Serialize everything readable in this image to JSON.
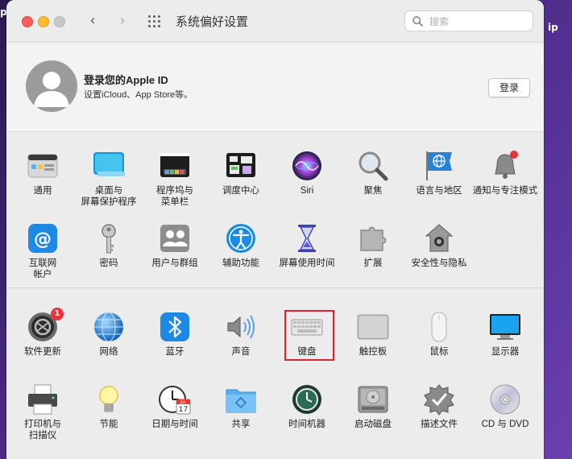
{
  "desktop": {
    "left_text": "p",
    "right_text": "ip"
  },
  "window": {
    "title": "系统偏好设置",
    "search_placeholder": "搜索",
    "back_symbol": "‹",
    "forward_symbol": "›"
  },
  "account": {
    "title": "登录您的Apple ID",
    "subtitle": "设置iCloud、App Store等。",
    "login_button": "登录"
  },
  "section1": [
    {
      "label": "通用",
      "icon": "general-icon"
    },
    {
      "label": "桌面与\n屏幕保护程序",
      "icon": "desktop-icon"
    },
    {
      "label": "程序坞与\n菜单栏",
      "icon": "dock-icon"
    },
    {
      "label": "调度中心",
      "icon": "mission-control-icon"
    },
    {
      "label": "Siri",
      "icon": "siri-icon"
    },
    {
      "label": "聚焦",
      "icon": "spotlight-icon"
    },
    {
      "label": "语言与地区",
      "icon": "language-icon"
    },
    {
      "label": "通知与专注模式",
      "icon": "notifications-icon"
    },
    {
      "label": "互联网\n帐户",
      "icon": "internet-accounts-icon"
    },
    {
      "label": "密码",
      "icon": "key-icon"
    },
    {
      "label": "用户与群组",
      "icon": "users-icon"
    },
    {
      "label": "辅助功能",
      "icon": "accessibility-icon"
    },
    {
      "label": "屏幕使用时间",
      "icon": "screen-time-icon"
    },
    {
      "label": "扩展",
      "icon": "extensions-icon"
    },
    {
      "label": "安全性与隐私",
      "icon": "security-icon"
    }
  ],
  "section2": [
    {
      "label": "软件更新",
      "icon": "software-update-icon",
      "badge": "1"
    },
    {
      "label": "网络",
      "icon": "network-icon"
    },
    {
      "label": "蓝牙",
      "icon": "bluetooth-icon"
    },
    {
      "label": "声音",
      "icon": "sound-icon"
    },
    {
      "label": "键盘",
      "icon": "keyboard-icon"
    },
    {
      "label": "触控板",
      "icon": "trackpad-icon"
    },
    {
      "label": "鼠标",
      "icon": "mouse-icon"
    },
    {
      "label": "显示器",
      "icon": "display-icon"
    },
    {
      "label": "打印机与\n扫描仪",
      "icon": "printer-icon"
    },
    {
      "label": "节能",
      "icon": "energy-saver-icon"
    },
    {
      "label": "日期与时间",
      "icon": "date-time-icon"
    },
    {
      "label": "共享",
      "icon": "sharing-icon"
    },
    {
      "label": "时间机器",
      "icon": "time-machine-icon"
    },
    {
      "label": "启动磁盘",
      "icon": "startup-disk-icon"
    },
    {
      "label": "描述文件",
      "icon": "profiles-icon"
    },
    {
      "label": "CD 与 DVD",
      "icon": "cd-dvd-icon"
    }
  ],
  "icon_text": {
    "at_symbol": "@",
    "calendar_month": "JUL",
    "calendar_day": "17"
  },
  "colors": {
    "highlight": "#e0202a",
    "badge": "#e8333a",
    "accent_blue": "#1e88e5"
  }
}
